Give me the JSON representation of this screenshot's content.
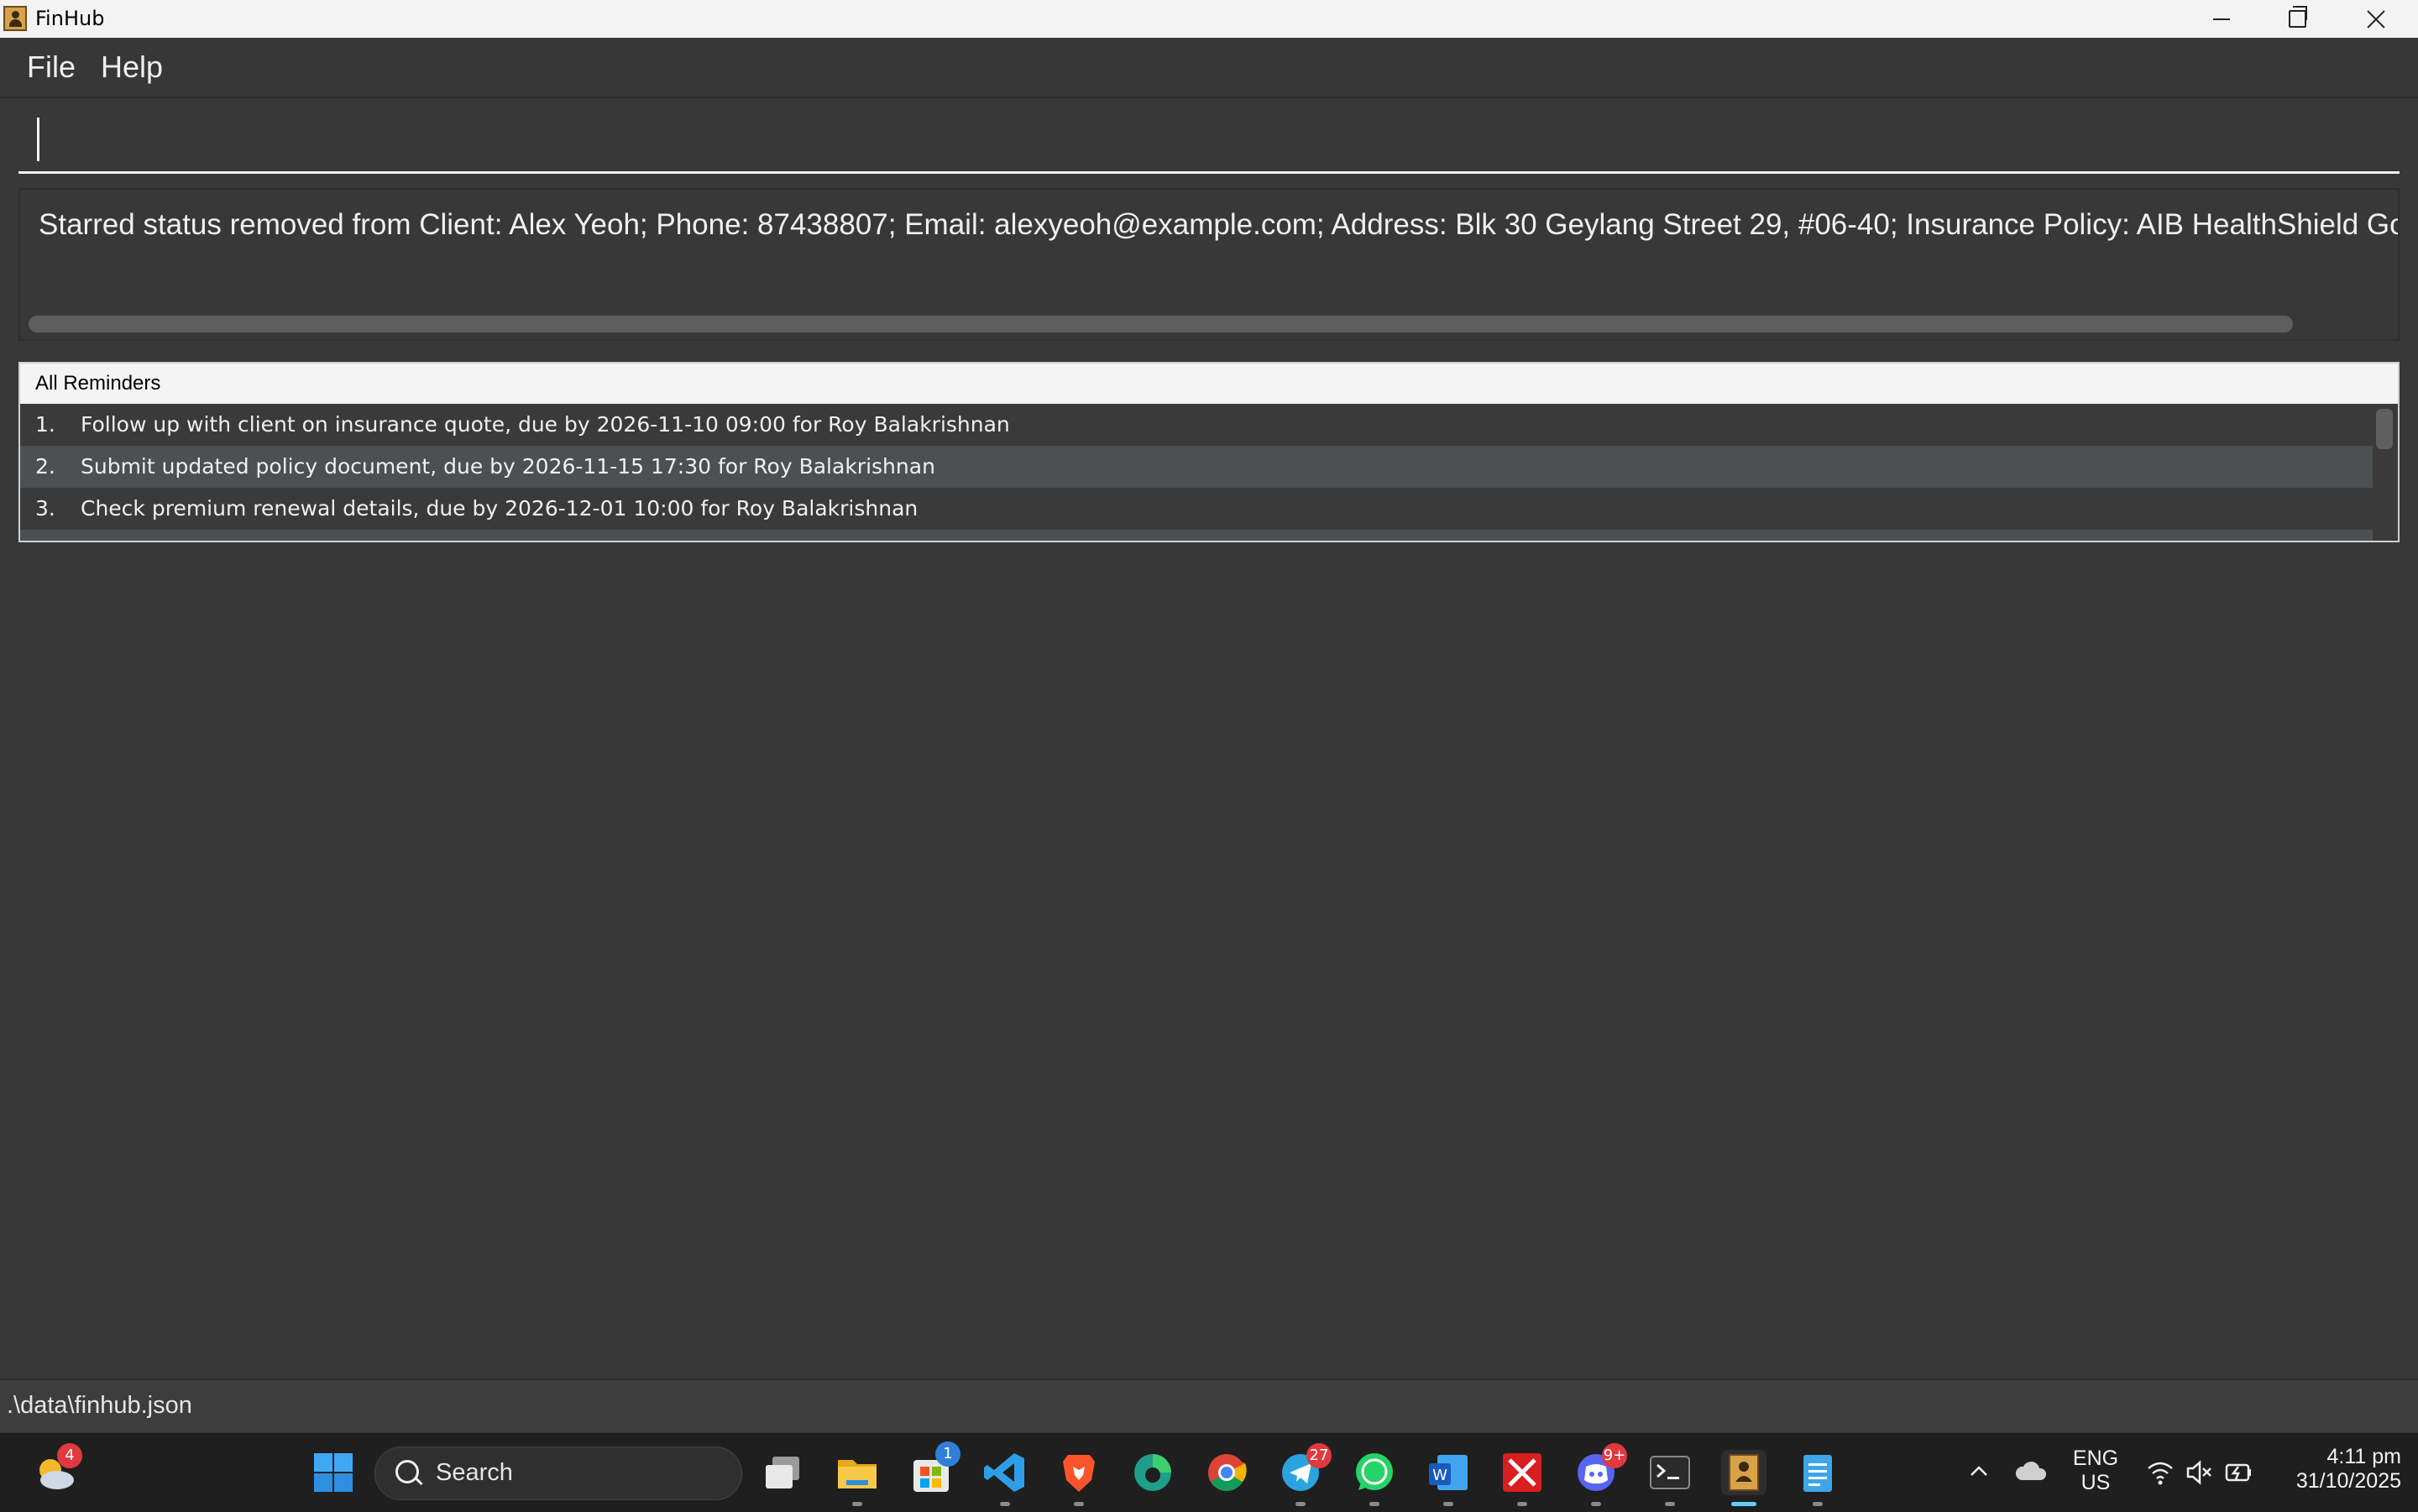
{
  "window": {
    "title": "FinHub"
  },
  "menu": {
    "file": "File",
    "help": "Help"
  },
  "command_box": {
    "value": ""
  },
  "result_display": {
    "text": "Starred status removed from Client: Alex Yeoh; Phone: 87438807; Email: alexyeoh@example.com; Address: Blk 30 Geylang Street 29, #06-40; Insurance Policy: AIB HealthShield Gold Max; Tags: [f"
  },
  "reminders": {
    "header": "All Reminders",
    "items": [
      {
        "index": "1.",
        "text": "Follow up with client on insurance quote, due by 2026-11-10 09:00 for Roy Balakrishnan"
      },
      {
        "index": "2.",
        "text": "Submit updated policy document, due by 2026-11-15 17:30 for Roy Balakrishnan"
      },
      {
        "index": "3.",
        "text": "Check premium renewal details, due by 2026-12-01 10:00 for Roy Balakrishnan"
      }
    ]
  },
  "status_bar": {
    "path": ".\\data\\finhub.json"
  },
  "taskbar": {
    "search_label": "Search",
    "weather_badge": "4",
    "store_badge": "1",
    "telegram_badge": "27",
    "discord_badge": "9+",
    "language_top": "ENG",
    "language_bottom": "US",
    "time": "4:11 pm",
    "date": "31/10/2025",
    "colors": {
      "accent": "#60cdff",
      "badge_red": "#e0393e",
      "badge_blue": "#2f7fd8"
    }
  }
}
